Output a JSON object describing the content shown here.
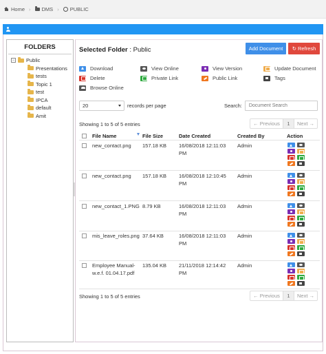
{
  "breadcrumb": {
    "home": "Home",
    "dms": "DMS",
    "public": "PUBLIC"
  },
  "folders": {
    "title": "FOLDERS",
    "toggle": "−",
    "root": "Public",
    "children": [
      "Presentations",
      "tests",
      "Topic 1",
      "test",
      "IPCA",
      "default",
      "Amit"
    ]
  },
  "main": {
    "selected_label": "Selected Folder",
    "selected_value": ": Public",
    "add_button": "Add Document",
    "refresh_button": "Refresh",
    "legend": [
      {
        "label": "Download",
        "color": "#3f8fe8",
        "icon": "download-icon"
      },
      {
        "label": "View Online",
        "color": "#555555",
        "icon": "eye-icon"
      },
      {
        "label": "View Version",
        "color": "#7b2db3",
        "icon": "info-icon"
      },
      {
        "label": "Update Document",
        "color": "#f0ad4e",
        "icon": "edit-icon"
      },
      {
        "label": "Delete",
        "color": "#d9342b",
        "icon": "trash-icon"
      },
      {
        "label": "Private Link",
        "color": "#2eaa3f",
        "icon": "external-link-icon"
      },
      {
        "label": "Public Link",
        "color": "#f0771f",
        "icon": "link-icon"
      },
      {
        "label": "Tags",
        "color": "#444444",
        "icon": "tag-icon"
      },
      {
        "label": "Browse Online",
        "color": "#555555",
        "icon": "cloud-icon"
      }
    ],
    "length_value": "20",
    "length_suffix": "records per page",
    "search_label": "Search:",
    "search_placeholder": "Document Search",
    "info_text": "Showing 1 to 5 of 5 entries",
    "pager": {
      "prev": "← Previous",
      "page": "1",
      "next": "Next →"
    },
    "columns": [
      "File Name",
      "File Size",
      "Date Created",
      "Created By",
      "Action"
    ],
    "rows": [
      {
        "name": "new_contact.png",
        "size": "157.18 KB",
        "date": "16/08/2018 12:11:03 PM",
        "by": "Admin"
      },
      {
        "name": "new_contact.png",
        "size": "157.18 KB",
        "date": "16/08/2018 12:10:45 PM",
        "by": "Admin"
      },
      {
        "name": "new_contact_1.PNG",
        "size": "8.79 KB",
        "date": "16/08/2018 12:11:03 PM",
        "by": "Admin"
      },
      {
        "name": "mis_leave_roles.png",
        "size": "37.64 KB",
        "date": "16/08/2018 12:11:03 PM",
        "by": "Admin"
      },
      {
        "name": "Employee Manual-w.e.f. 01.04.17.pdf",
        "size": "135.04 KB",
        "date": "21/11/2018 12:14:42 PM",
        "by": "Admin"
      }
    ]
  }
}
